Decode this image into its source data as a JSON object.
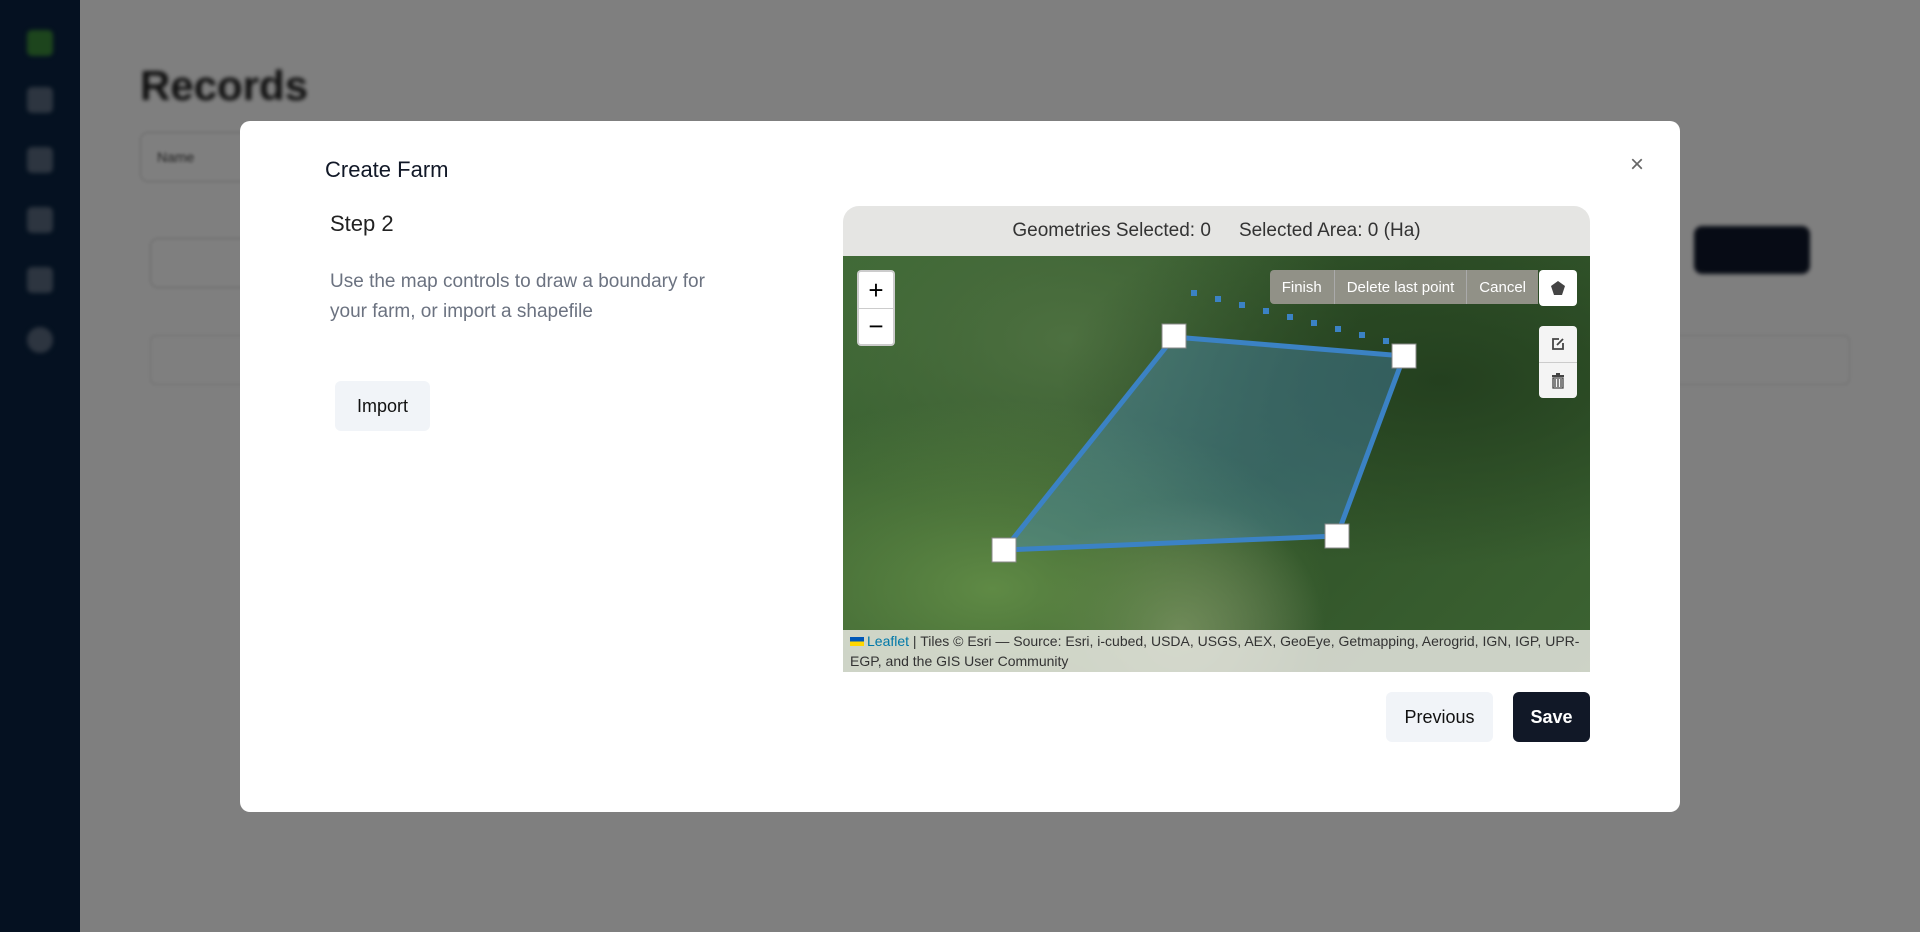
{
  "background": {
    "page_title": "Records",
    "filter_label": "Name"
  },
  "modal": {
    "title": "Create Farm",
    "close_icon": "×",
    "step": "Step 2",
    "description": "Use the map controls to draw a boundary for your farm, or import a shapefile",
    "import_label": "Import",
    "previous_label": "Previous",
    "save_label": "Save"
  },
  "map": {
    "geometries_selected": "Geometries Selected: 0",
    "selected_area": "Selected Area: 0 (Ha)",
    "zoom_in": "+",
    "zoom_out": "−",
    "draw_actions": [
      "Finish",
      "Delete last point",
      "Cancel"
    ],
    "tools": [
      "polygon-icon",
      "edit-icon",
      "trash-icon"
    ],
    "attribution_link": "Leaflet",
    "attribution_text": " | Tiles © Esri — Source: Esri, i-cubed, USDA, USGS, AEX, GeoEye, Getmapping, Aerogrid, IGN, IGP, UPR-EGP, and the GIS User Community",
    "polygon_color": "#3b82c4"
  }
}
